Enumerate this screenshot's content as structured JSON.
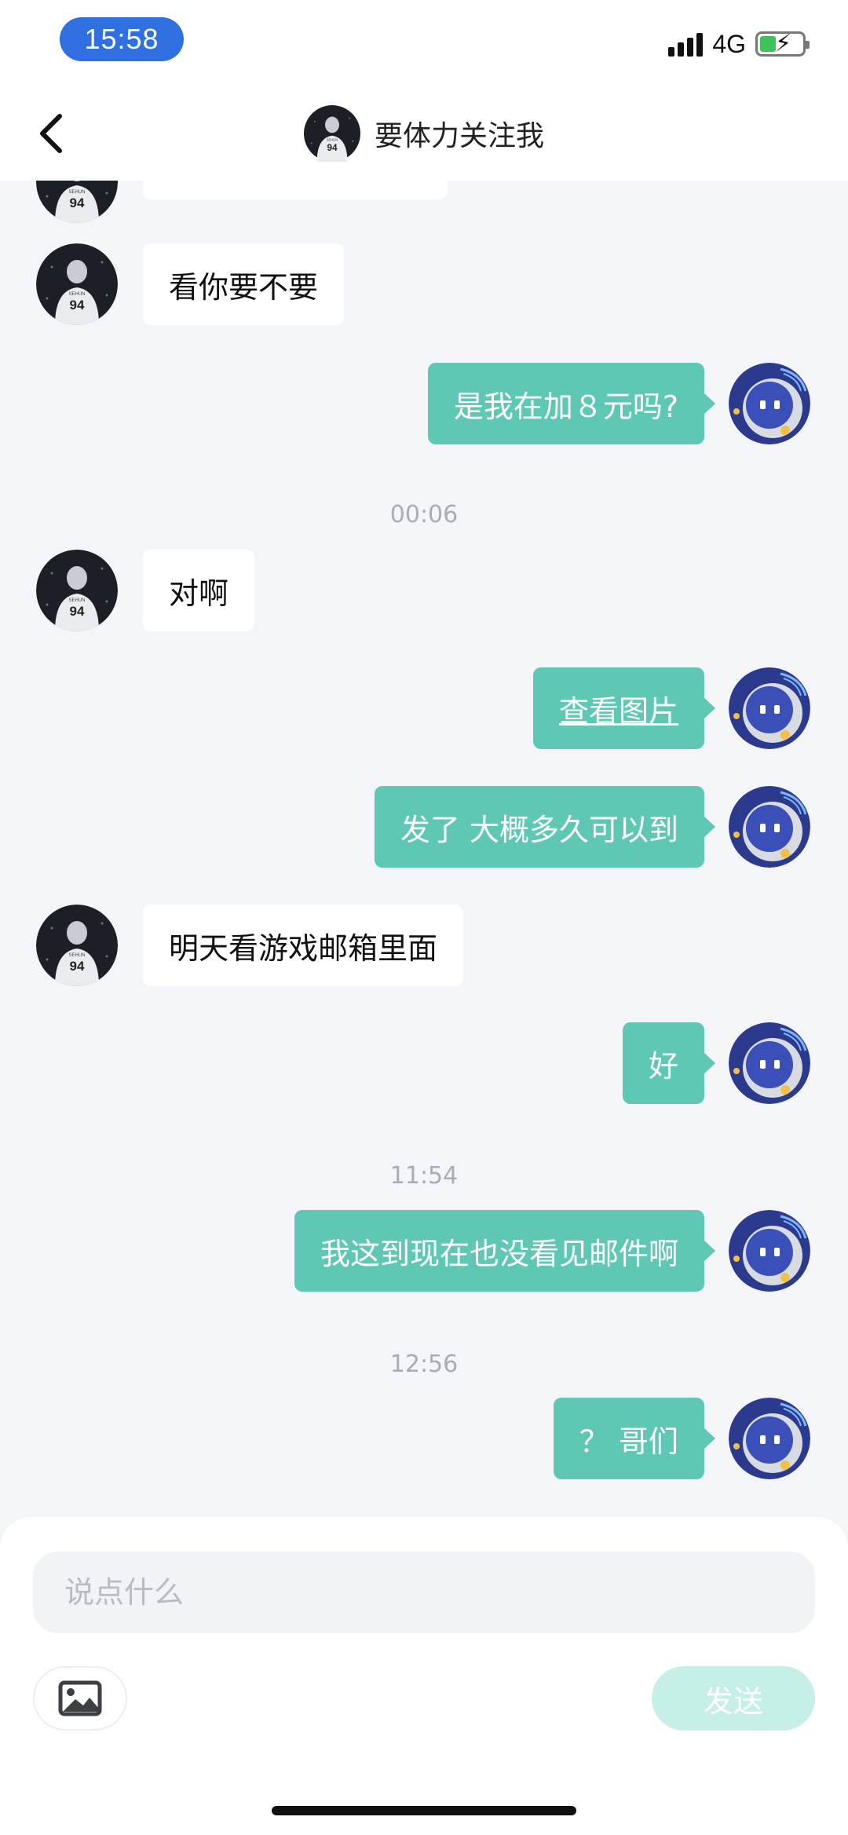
{
  "status_bar": {
    "time": "15:58",
    "network": "4G",
    "icons": [
      "cellular-signal-icon",
      "battery-charging-icon"
    ],
    "battery_color": "#3fc25a"
  },
  "header": {
    "title": "要体力关注我",
    "icons": [
      "back-chevron-icon",
      "contact-avatar"
    ]
  },
  "messages": {
    "partial_top": "",
    "m1": "看你要不要",
    "m2": "是我在加８元吗?",
    "t1": "00:06",
    "m3": "对啊",
    "m4": "查看图片",
    "m5": "发了 大概多久可以到",
    "m6": "明天看游戏邮箱里面",
    "m7": "好",
    "t2": "11:54",
    "m8": "我这到现在也没看见邮件啊",
    "t3": "12:56",
    "m9": "？ 哥们"
  },
  "input": {
    "placeholder": "说点什么",
    "send_label": "发送",
    "image_icon": "image-icon"
  },
  "colors": {
    "outgoing_bubble": "#5ec8b5",
    "incoming_bubble": "#ffffff",
    "background": "#f4f5f8",
    "send_button_disabled": "#c5efe7",
    "time_pill": "#2f6fe0"
  }
}
